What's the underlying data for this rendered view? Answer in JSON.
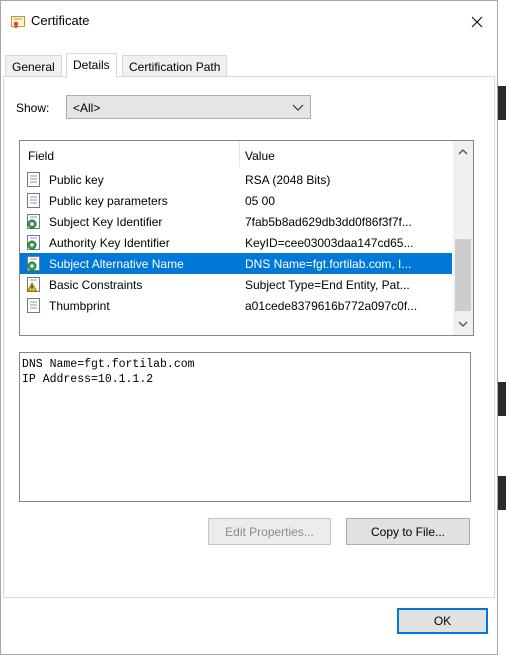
{
  "window": {
    "title": "Certificate"
  },
  "tabs": [
    {
      "label": "General",
      "active": false
    },
    {
      "label": "Details",
      "active": true
    },
    {
      "label": "Certification Path",
      "active": false
    }
  ],
  "show": {
    "label": "Show:",
    "selected": "<All>"
  },
  "list": {
    "columns": [
      "Field",
      "Value"
    ],
    "rows": [
      {
        "field": "Public key",
        "value": "RSA (2048 Bits)",
        "icon": "certificate-field-icon"
      },
      {
        "field": "Public key parameters",
        "value": "05 00",
        "icon": "certificate-field-icon"
      },
      {
        "field": "Subject Key Identifier",
        "value": "7fab5b8ad629db3dd0f86f3f7f...",
        "icon": "extension-icon"
      },
      {
        "field": "Authority Key Identifier",
        "value": "KeyID=cee03003daa147cd65...",
        "icon": "extension-icon"
      },
      {
        "field": "Subject Alternative Name",
        "value": "DNS Name=fgt.fortilab.com, I...",
        "icon": "extension-icon",
        "selected": true
      },
      {
        "field": "Basic Constraints",
        "value": "Subject Type=End Entity, Pat...",
        "icon": "critical-extension-icon"
      },
      {
        "field": "Thumbprint",
        "value": "a01cede8379616b772a097c0f...",
        "icon": "certificate-field-icon"
      }
    ]
  },
  "detail": {
    "lines": [
      "DNS Name=fgt.fortilab.com",
      "IP Address=10.1.1.2"
    ]
  },
  "buttons": {
    "edit_properties": "Edit Properties...",
    "copy_to_file": "Copy to File...",
    "ok": "OK"
  },
  "colors": {
    "selection": "#0078d7",
    "default_button_border": "#0078d7"
  }
}
